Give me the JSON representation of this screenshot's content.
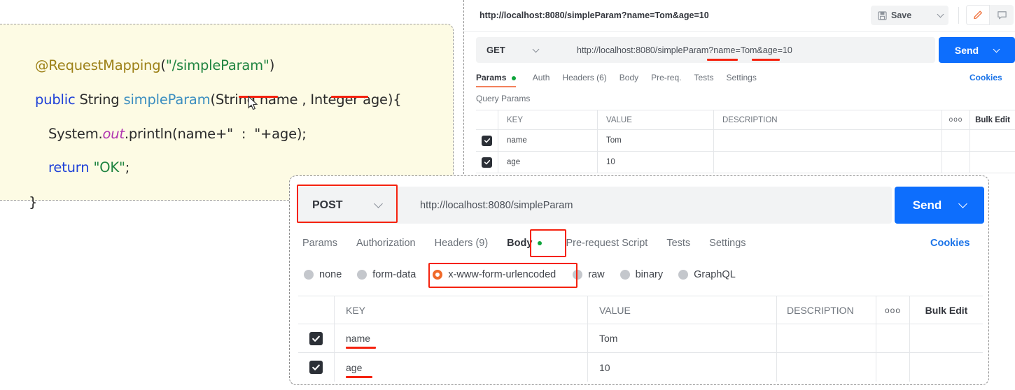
{
  "code_panel": {
    "language": "java",
    "lines": [
      {
        "tokens": [
          {
            "t": "@RequestMapping",
            "c": "anno"
          },
          {
            "t": "(",
            "c": "plain"
          },
          {
            "t": "\"/simpleParam\"",
            "c": "str"
          },
          {
            "t": ")",
            "c": "plain"
          }
        ]
      },
      {
        "tokens": [
          {
            "t": "public",
            "c": "kw"
          },
          {
            "t": " String ",
            "c": "type"
          },
          {
            "t": "simpleParam",
            "c": "meth"
          },
          {
            "t": "(String name , Integer age){",
            "c": "plain"
          }
        ]
      },
      {
        "tokens": [
          {
            "t": "System.",
            "c": "plain"
          },
          {
            "t": "out",
            "c": "field"
          },
          {
            "t": ".println(name+\"  :  \"+age);",
            "c": "plain"
          }
        ]
      },
      {
        "tokens": [
          {
            "t": "return",
            "c": "kw"
          },
          {
            "t": " ",
            "c": "plain"
          },
          {
            "t": "\"OK\"",
            "c": "str"
          },
          {
            "t": ";",
            "c": "plain"
          }
        ]
      },
      {
        "tokens": [
          {
            "t": "}",
            "c": "plain"
          }
        ]
      }
    ],
    "highlight_params": [
      "name",
      "age"
    ]
  },
  "get_request": {
    "saved_url": "http://localhost:8080/simpleParam?name=Tom&age=10",
    "save_label": "Save",
    "method": "GET",
    "url": "http://localhost:8080/simpleParam?name=Tom&age=10",
    "send_label": "Send",
    "cookies_label": "Cookies",
    "tabs": [
      {
        "label": "Params",
        "active": true,
        "dot": true
      },
      {
        "label": "Auth",
        "active": false,
        "dot": false
      },
      {
        "label": "Headers (6)",
        "active": false,
        "dot": false
      },
      {
        "label": "Body",
        "active": false,
        "dot": false
      },
      {
        "label": "Pre-req.",
        "active": false,
        "dot": false
      },
      {
        "label": "Tests",
        "active": false,
        "dot": false
      },
      {
        "label": "Settings",
        "active": false,
        "dot": false
      }
    ],
    "section_label": "Query Params",
    "table": {
      "headers": [
        "KEY",
        "VALUE",
        "DESCRIPTION"
      ],
      "more_label": "ooo",
      "bulk_edit_label": "Bulk Edit",
      "rows": [
        {
          "checked": true,
          "key": "name",
          "value": "Tom",
          "description": ""
        },
        {
          "checked": true,
          "key": "age",
          "value": "10",
          "description": ""
        }
      ]
    }
  },
  "post_request": {
    "method": "POST",
    "url": "http://localhost:8080/simpleParam",
    "send_label": "Send",
    "cookies_label": "Cookies",
    "tabs": [
      {
        "label": "Params",
        "active": false,
        "dot": false
      },
      {
        "label": "Authorization",
        "active": false,
        "dot": false
      },
      {
        "label": "Headers (9)",
        "active": false,
        "dot": false
      },
      {
        "label": "Body",
        "active": true,
        "dot": true
      },
      {
        "label": "Pre-request Script",
        "active": false,
        "dot": false
      },
      {
        "label": "Tests",
        "active": false,
        "dot": false
      },
      {
        "label": "Settings",
        "active": false,
        "dot": false
      }
    ],
    "body_types": [
      {
        "label": "none",
        "selected": false
      },
      {
        "label": "form-data",
        "selected": false
      },
      {
        "label": "x-www-form-urlencoded",
        "selected": true
      },
      {
        "label": "raw",
        "selected": false
      },
      {
        "label": "binary",
        "selected": false
      },
      {
        "label": "GraphQL",
        "selected": false
      }
    ],
    "table": {
      "headers": [
        "KEY",
        "VALUE",
        "DESCRIPTION"
      ],
      "more_label": "ooo",
      "bulk_edit_label": "Bulk Edit",
      "rows": [
        {
          "checked": true,
          "key": "name",
          "value": "Tom",
          "description": ""
        },
        {
          "checked": true,
          "key": "age",
          "value": "10",
          "description": ""
        }
      ]
    }
  },
  "colors": {
    "send_blue": "#0d6efd",
    "accent_orange": "#f2815c",
    "radio_orange": "#f06a2a",
    "annotation_red": "#f5220f",
    "link_blue": "#1a73e8",
    "code_bg": "#fdfbe4",
    "green_dot": "#0fa43c"
  }
}
